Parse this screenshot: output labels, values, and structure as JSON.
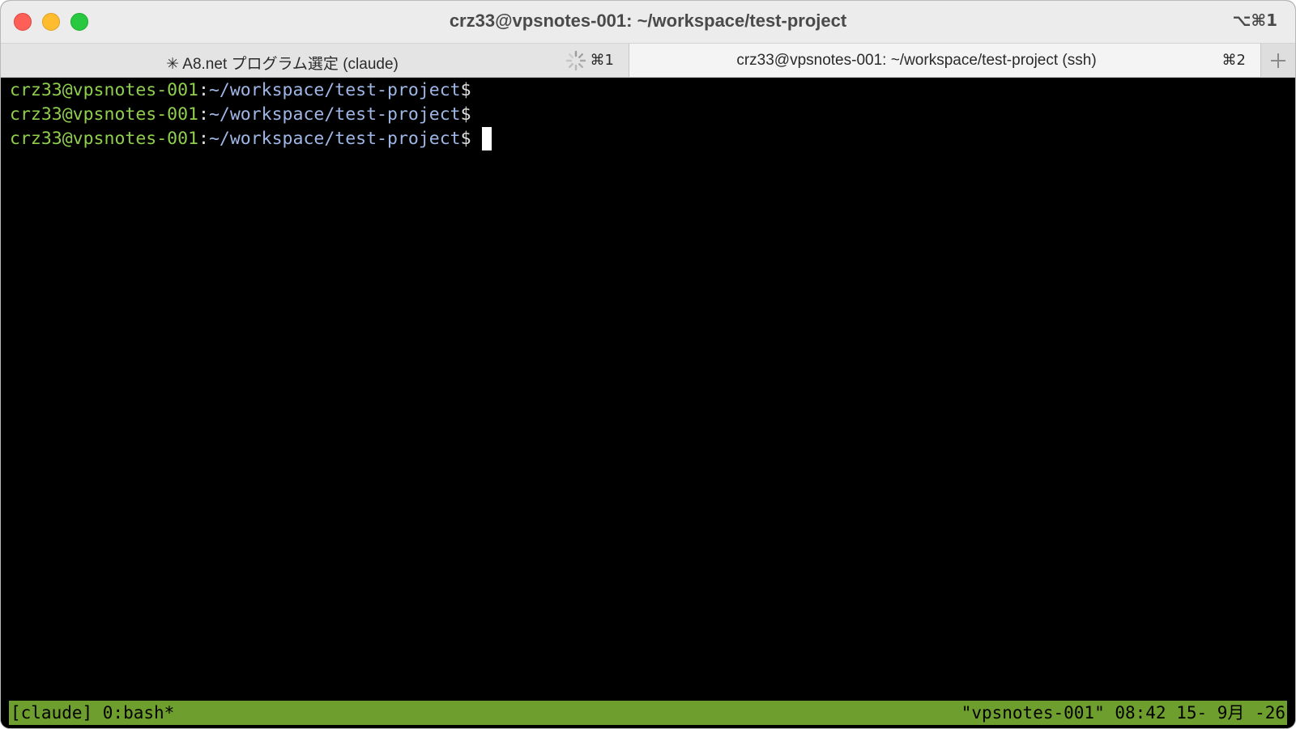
{
  "window": {
    "title": "crz33@vpsnotes-001: ~/workspace/test-project",
    "shortcut": "⌥⌘1"
  },
  "tabs": [
    {
      "label": "✳ A8.net プログラム選定 (claude)",
      "shortcut": "⌘1",
      "loading": true
    },
    {
      "label": "crz33@vpsnotes-001: ~/workspace/test-project (ssh)",
      "shortcut": "⌘2",
      "active": true
    }
  ],
  "terminal": {
    "prompt_user": "crz33@vpsnotes-001",
    "prompt_sep": ":",
    "prompt_path": "~/workspace/test-project",
    "prompt_symbol": "$",
    "lines": 3
  },
  "statusbar": {
    "left": "[claude] 0:bash*",
    "right": "\"vpsnotes-001\" 08:42 15- 9月 -26",
    "color": "#6e9e2e"
  },
  "colors": {
    "prompt_user": "#8fcf4c",
    "prompt_path": "#9fb7e6",
    "background": "#000000"
  }
}
